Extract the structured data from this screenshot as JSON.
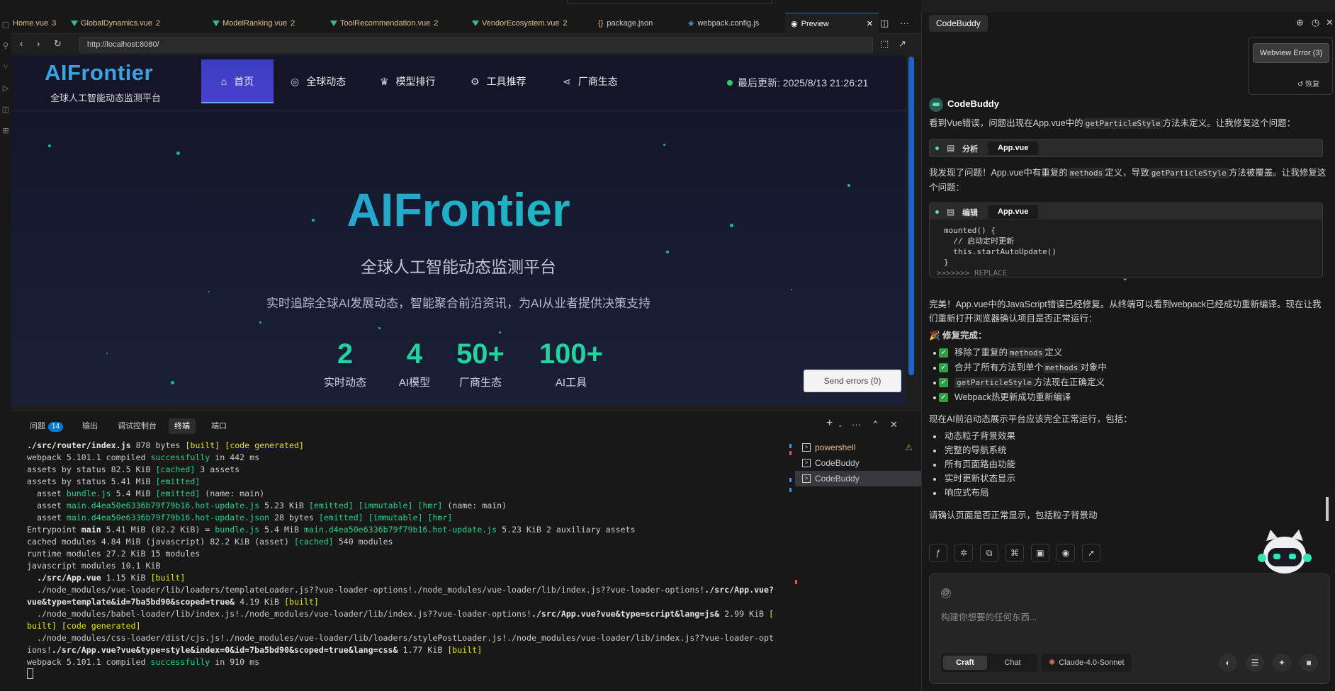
{
  "editor_tabs": [
    {
      "label": "Home.vue",
      "badge": "3"
    },
    {
      "label": "GlobalDynamics.vue",
      "badge": "2"
    },
    {
      "label": "ModelRanking.vue",
      "badge": "2"
    },
    {
      "label": "ToolRecommendation.vue",
      "badge": "2"
    },
    {
      "label": "VendorEcosystem.vue",
      "badge": "2"
    },
    {
      "label": "package.json",
      "badge": ""
    },
    {
      "label": "webpack.config.js",
      "badge": ""
    },
    {
      "label": "Preview",
      "badge": ""
    }
  ],
  "browser": {
    "url": "http://localhost:8080/"
  },
  "preview": {
    "logo": "AIFrontier",
    "logo_sub": "全球人工智能动态监测平台",
    "menu": [
      "首页",
      "全球动态",
      "模型排行",
      "工具推荐",
      "厂商生态"
    ],
    "last_update": "最后更新: 2025/8/13 21:26:21",
    "hero_title": "AIFrontier",
    "hero_sub": "全球人工智能动态监测平台",
    "hero_desc": "实时追踪全球AI发展动态，智能聚合前沿资讯，为AI从业者提供决策支持",
    "stats": [
      {
        "value": "2",
        "label": "实时动态"
      },
      {
        "value": "4",
        "label": "AI模型"
      },
      {
        "value": "50+",
        "label": "厂商生态"
      },
      {
        "value": "100+",
        "label": "AI工具"
      }
    ],
    "send_errors": "Send errors (0)"
  },
  "panel": {
    "tabs": [
      {
        "label": "问题",
        "count": "14"
      },
      {
        "label": "输出",
        "count": ""
      },
      {
        "label": "调试控制台",
        "count": ""
      },
      {
        "label": "终端",
        "count": ""
      },
      {
        "label": "端口",
        "count": ""
      }
    ],
    "terminals": [
      "powershell",
      "CodeBuddy",
      "CodeBuddy"
    ]
  },
  "sidebar": {
    "title": "CodeBuddy",
    "webview_error": "Webview Error (3)",
    "restore": "恢复",
    "assistant_name": "CodeBuddy",
    "msg1_pre": "看到Vue错误，问题出现在App.vue中的",
    "msg1_code": "getParticleStyle",
    "msg1_post": "方法未定义。让我修复这个问题：",
    "tool1_action": "分析",
    "tool1_file": "App.vue",
    "msg2_a": "我发现了问题！App.vue中有重复的",
    "msg2_code1": "methods",
    "msg2_b": "定义，导致",
    "msg2_code2": "getParticleStyle",
    "msg2_c": "方法被覆盖。让我修复这个问题：",
    "tool2_action": "编辑",
    "tool2_file": "App.vue",
    "code_lines": [
      "mounted() {",
      "  // 启动定时更新",
      "  this.startAutoUpdate()",
      "}",
      ">>>>>>> REPLACE"
    ],
    "msg3": "完美！App.vue中的JavaScript错误已经修复。从终端可以看到webpack已经成功重新编译。现在让我们重新打开浏览器确认项目是否正常运行：",
    "fix_title": "🎉 修复完成：",
    "checks": [
      {
        "pre": "移除了重复的",
        "code": "methods",
        "post": "定义"
      },
      {
        "pre": "合并了所有方法到单个",
        "code": "methods",
        "post": "对象中"
      },
      {
        "pre": "",
        "code": "getParticleStyle",
        "post": "方法现在正确定义"
      },
      {
        "pre": "Webpack热更新成功重新编译",
        "code": "",
        "post": ""
      }
    ],
    "msg4": "现在AI前沿动态展示平台应该完全正常运行，包括：",
    "features": [
      "动态粒子背景效果",
      "完整的导航系统",
      "所有页面路由功能",
      "实时更新状态显示",
      "响应式布局"
    ],
    "msg5": "请确认页面是否正常显示，包括粒子背景动",
    "input_placeholder": "构建你想要的任何东西...",
    "mode_craft": "Craft",
    "mode_chat": "Chat",
    "model": "Claude-4.0-Sonnet"
  },
  "colors": {
    "accent": "#0078d4",
    "brand_teal": "#22d39e",
    "nav_active": "#3a3fbf"
  }
}
